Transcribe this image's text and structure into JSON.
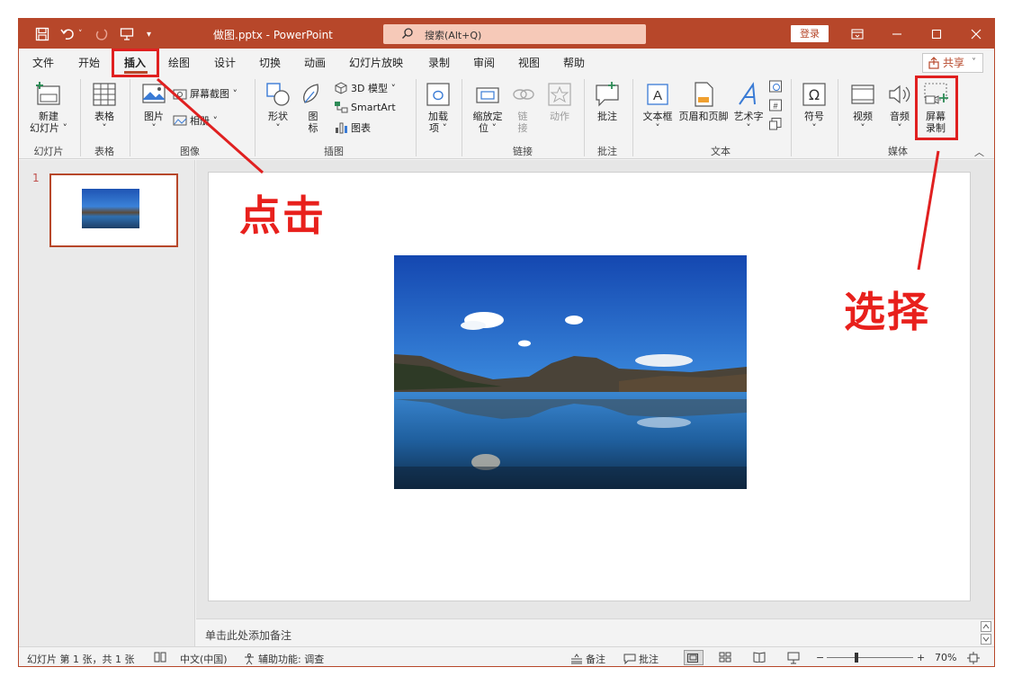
{
  "window": {
    "doc_title": "做图.pptx  -  PowerPoint",
    "search_text": "搜索(Alt+Q)",
    "login_label": "登录"
  },
  "tabs": [
    "文件",
    "开始",
    "插入",
    "绘图",
    "设计",
    "切换",
    "动画",
    "幻灯片放映",
    "录制",
    "审阅",
    "视图",
    "帮助"
  ],
  "active_tab": "插入",
  "share_label": "共享",
  "ribbon": {
    "new_slide": [
      "新建",
      "幻灯片 ˅"
    ],
    "table": [
      "表格",
      "˅"
    ],
    "picture": [
      "图片",
      "˅"
    ],
    "screenshot": "屏幕截图 ˅",
    "album": "相册 ˅",
    "shapes": [
      "形状",
      "˅"
    ],
    "icons": [
      "图",
      "标"
    ],
    "model3d": "3D 模型  ˅",
    "smartart": "SmartArt",
    "chart": "图表",
    "addins": [
      "加载",
      "项 ˅"
    ],
    "zoom": [
      "缩放定",
      "位 ˅"
    ],
    "link": [
      "链",
      "接"
    ],
    "action": "动作",
    "comment": "批注",
    "textbox": [
      "文本框",
      "˅"
    ],
    "header_footer": "页眉和页脚",
    "wordart": [
      "艺术字",
      "˅"
    ],
    "symbol": [
      "符号",
      "˅"
    ],
    "video": [
      "视频",
      "˅"
    ],
    "audio": [
      "音频",
      "˅"
    ],
    "screen_record": [
      "屏幕",
      "录制"
    ],
    "groups": {
      "slides": "幻灯片",
      "tables": "表格",
      "images": "图像",
      "illustrations": "插图",
      "links": "链接",
      "comments": "批注",
      "text": "文本",
      "media": "媒体"
    }
  },
  "thumbnail": {
    "number": "1"
  },
  "notes_placeholder": "单击此处添加备注",
  "status": {
    "slide_info": "幻灯片 第 1 张，共 1 张",
    "language": "中文(中国)",
    "accessibility": "辅助功能: 调查",
    "notes_btn": "备注",
    "comments_btn": "批注",
    "zoom_minus": "−",
    "zoom_plus": "+",
    "zoom_level": "70%"
  },
  "annotations": {
    "click": "点击",
    "select": "选择"
  },
  "colors": {
    "accent": "#b7472a",
    "annotation": "#e02020"
  }
}
